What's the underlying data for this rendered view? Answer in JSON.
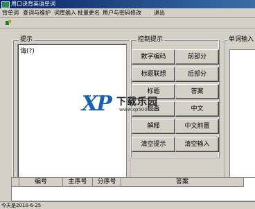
{
  "window": {
    "title": "用口诀背英语单词"
  },
  "menu": [
    "背单词",
    "查词与维护",
    "词库输入",
    "批量更名",
    "用户与密码修改",
    "退出"
  ],
  "hint_group": {
    "label": "提示",
    "content": "诲(?)"
  },
  "control_group": {
    "label": "控制提示",
    "buttons": [
      "数字编码",
      "前部分",
      "标题联想",
      "后部分",
      "标题",
      "答案",
      "检查",
      "中文",
      "解释",
      "中文前置",
      "清空提示",
      "清空输入"
    ]
  },
  "word_input": {
    "label": "单词输入"
  },
  "table": {
    "columns": [
      "编号",
      "主序号",
      "分序号",
      "答案"
    ]
  },
  "status": {
    "text": "今天是2010-6-25"
  },
  "watermark": {
    "logo": "XP",
    "name": "下载乐园",
    "url": "www.xp500.com"
  }
}
